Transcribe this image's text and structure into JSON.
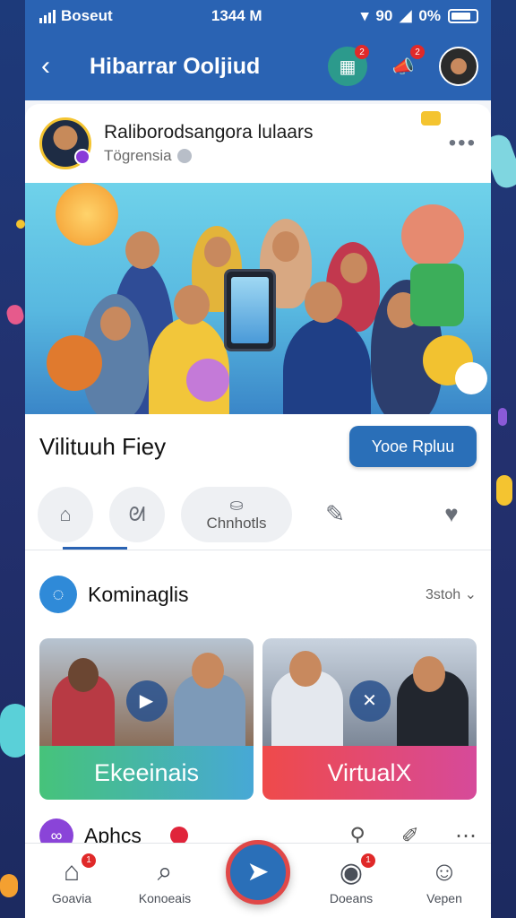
{
  "status": {
    "carrier": "Boseut",
    "time": "1344 M",
    "network": "90",
    "battery": "0%"
  },
  "header": {
    "title": "Hibarrar Ooljiud",
    "icons": {
      "back": "chevron-left-icon",
      "store": "store-icon",
      "notify": "megaphone-icon"
    },
    "badges": {
      "store": "2",
      "notify": "2"
    }
  },
  "post": {
    "author": "Raliborodsangora lulaars",
    "subtitle": "Tögrensia",
    "more": "•••"
  },
  "feature": {
    "title": "Vilituuh Fiey",
    "cta": "Yooe Rpluu"
  },
  "tabs": [
    {
      "icon": "home-icon"
    },
    {
      "icon": "swirl-icon"
    },
    {
      "icon": "cart-icon",
      "label": "Chnhotls"
    },
    {
      "icon": "feather-icon"
    },
    {
      "icon": "heart-icon"
    }
  ],
  "group": {
    "title": "Kominaglis",
    "sort": "3stoh ⌄"
  },
  "tiles": [
    {
      "label": "Ekeeinais",
      "icon": "video-icon"
    },
    {
      "label": "VirtualX",
      "icon": "tools-icon"
    }
  ],
  "apps": {
    "title": "Aphcs"
  },
  "bottom_nav": [
    {
      "label": "Goavia",
      "icon": "house-icon",
      "badge": "1"
    },
    {
      "label": "Konoeais",
      "icon": "search-icon"
    },
    {
      "label": "",
      "icon": "send-icon"
    },
    {
      "label": "Doeans",
      "icon": "cookie-icon",
      "badge": "1"
    },
    {
      "label": "Vepen",
      "icon": "user-icon"
    }
  ],
  "colors": {
    "primary": "#2a63b3",
    "accent_red": "#e04848",
    "green": "#46c37a"
  }
}
